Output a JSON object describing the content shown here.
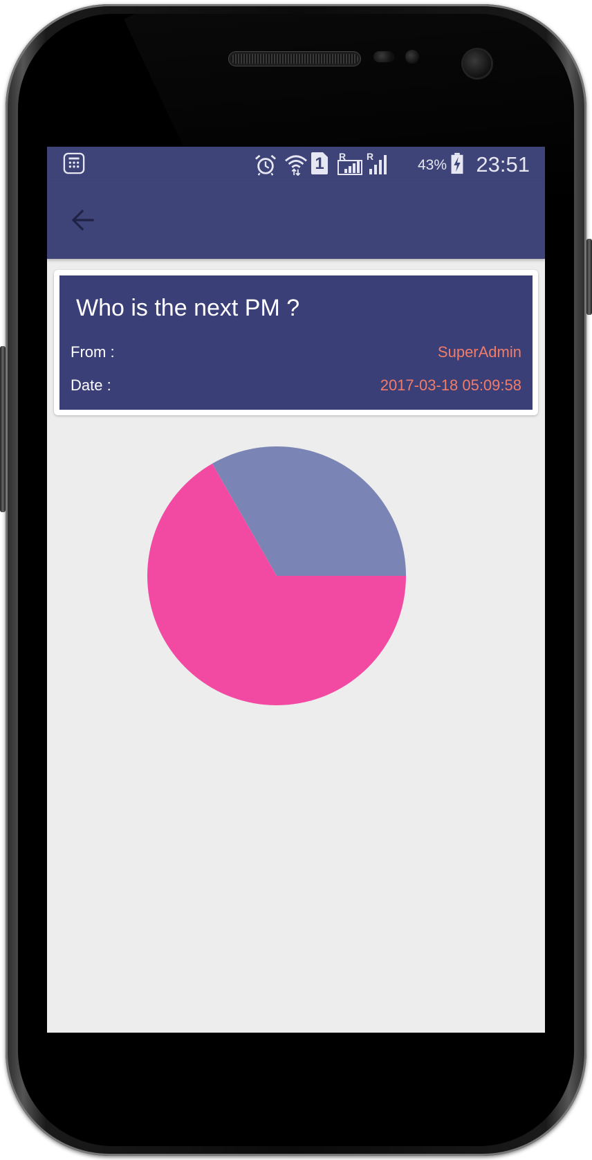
{
  "status_bar": {
    "battery_percent": "43%",
    "time": "23:51",
    "sim_slot": "1",
    "roaming_1": "R",
    "roaming_2": "R"
  },
  "app_bar": {
    "back_icon": "arrow-left-icon"
  },
  "poll": {
    "title": "Who is the next PM ?",
    "from_label": "From :",
    "from_value": "SuperAdmin",
    "date_label": "Date :",
    "date_value": "2017-03-18 05:09:58"
  },
  "colors": {
    "primary": "#3f4478",
    "card_bg": "#3b3f77",
    "accent_text": "#f07c6a",
    "screen_bg": "#ededed"
  },
  "chart_data": {
    "type": "pie",
    "slices": [
      {
        "value": 33.3,
        "color": "#7a85b6"
      },
      {
        "value": 66.7,
        "color": "#f24aa2"
      }
    ],
    "start_angle_deg": 0,
    "direction": "counterclockwise"
  }
}
